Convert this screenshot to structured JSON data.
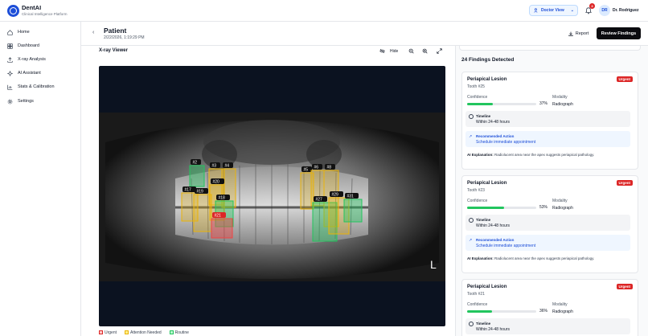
{
  "app": {
    "name": "DentAI",
    "subtitle": "Clinical Intelligence Platform"
  },
  "topbar": {
    "view_label": "Doctor View",
    "notification_count": "3",
    "avatar_initials": "DR",
    "user_name": "Dr. Rodriguez"
  },
  "sidebar": {
    "items": [
      {
        "label": "Home",
        "icon": "home-icon"
      },
      {
        "label": "Dashboard",
        "icon": "grid-icon"
      },
      {
        "label": "X-ray Analysis",
        "icon": "upload-icon"
      },
      {
        "label": "AI Assistant",
        "icon": "sparkle-icon"
      },
      {
        "label": "Stats & Calibration",
        "icon": "bar-chart-icon"
      },
      {
        "label": "Settings",
        "icon": "gear-icon"
      }
    ]
  },
  "header": {
    "title": "Patient",
    "date": "2/22/2026, 1:19:29 PM",
    "report_label": "Report",
    "review_label": "Review Findings"
  },
  "xray": {
    "title": "X-ray Viewer",
    "hide_label": "Hide",
    "orientation_marker": "L",
    "boxes": [
      {
        "label": "#2",
        "severity": "routine"
      },
      {
        "label": "#3",
        "severity": "attention"
      },
      {
        "label": "#4",
        "severity": "attention"
      },
      {
        "label": "#20",
        "severity": "attention"
      },
      {
        "label": "#17",
        "severity": "attention"
      },
      {
        "label": "#19",
        "severity": "attention"
      },
      {
        "label": "#18",
        "severity": "routine"
      },
      {
        "label": "#21",
        "severity": "urgent"
      },
      {
        "label": "#5",
        "severity": "attention"
      },
      {
        "label": "#6",
        "severity": "attention"
      },
      {
        "label": "#8",
        "severity": "attention"
      },
      {
        "label": "#27",
        "severity": "routine"
      },
      {
        "label": "#29",
        "severity": "attention"
      },
      {
        "label": "#31",
        "severity": "routine"
      }
    ],
    "legend": [
      {
        "label": "Urgent",
        "color": "#dc2626"
      },
      {
        "label": "Attention Needed",
        "color": "#eab308"
      },
      {
        "label": "Routine",
        "color": "#22c55e"
      }
    ]
  },
  "findings": {
    "count_label": "24 Findings Detected",
    "cards": [
      {
        "title": "Periapical Lesion",
        "tooth": "Tooth #25",
        "badge": "Urgent",
        "confidence_label": "Confidence",
        "confidence_value": 37,
        "confidence_text": "37%",
        "modality_label": "Modality",
        "modality": "Radiograph",
        "timeline_label": "Timeline",
        "timeline": "Within 24-48 hours",
        "action_label": "Recommended Action",
        "action": "Schedule immediate appointment",
        "ai_label": "AI Explanation:",
        "ai_text": "Radiolucent area near the apex suggests periapical pathology."
      },
      {
        "title": "Periapical Lesion",
        "tooth": "Tooth #23",
        "badge": "Urgent",
        "confidence_label": "Confidence",
        "confidence_value": 53,
        "confidence_text": "53%",
        "modality_label": "Modality",
        "modality": "Radiograph",
        "timeline_label": "Timeline",
        "timeline": "Within 24-48 hours",
        "action_label": "Recommended Action",
        "action": "Schedule immediate appointment",
        "ai_label": "AI Explanation:",
        "ai_text": "Radiolucent area near the apex suggests periapical pathology."
      },
      {
        "title": "Periapical Lesion",
        "tooth": "Tooth #21",
        "badge": "Urgent",
        "confidence_label": "Confidence",
        "confidence_value": 36,
        "confidence_text": "36%",
        "modality_label": "Modality",
        "modality": "Radiograph",
        "timeline_label": "Timeline",
        "timeline": "Within 24-48 hours"
      }
    ]
  }
}
